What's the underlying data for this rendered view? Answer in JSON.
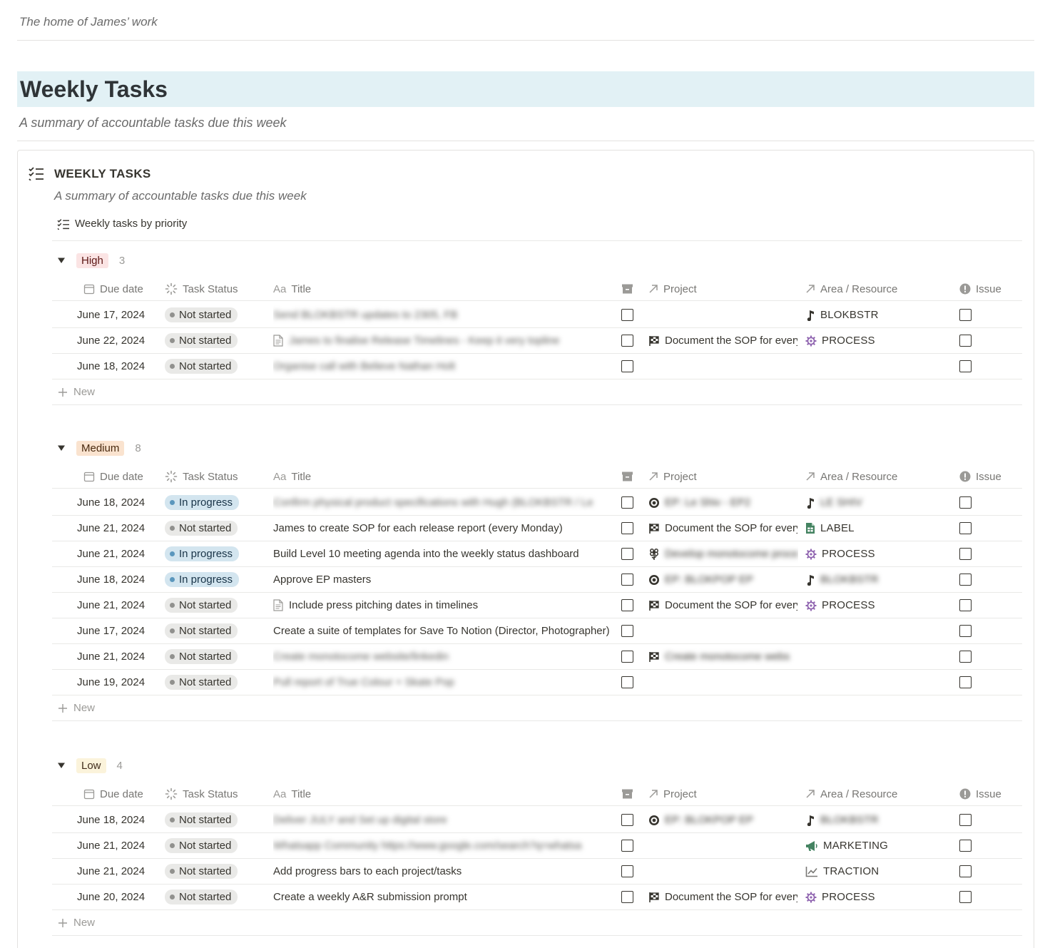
{
  "breadcrumb": "The home of James’ work",
  "page": {
    "title": "Weekly Tasks",
    "subtitle": "A summary of accountable tasks due this week"
  },
  "card": {
    "title": "WEEKLY TASKS",
    "subtitle": "A summary of accountable tasks due this week",
    "view_tab": "Weekly tasks by priority"
  },
  "columns": {
    "due_date": "Due date",
    "task_status": "Task Status",
    "title": "Title",
    "title_prefix": "Aa",
    "project": "Project",
    "area": "Area / Resource",
    "issue": "Issue"
  },
  "new_label": "New",
  "colors": {
    "page_title_bg": "#e2f1f5",
    "high_tag_bg": "#fbe4e4",
    "high_tag_fg": "#5d1715",
    "medium_tag_bg": "#fae3cf",
    "medium_tag_fg": "#49290e",
    "low_tag_bg": "#fbf3db",
    "low_tag_fg": "#402c1b",
    "status_not_started_bg": "#e9e9e7",
    "status_in_progress_bg": "#d3e5ef",
    "process_icon": "#9065b0",
    "label_icon": "#448361",
    "marketing_icon": "#448361",
    "traction_icon": "#787774"
  },
  "groups": [
    {
      "name": "High",
      "count": "3",
      "tag": "high",
      "rows": [
        {
          "date": "June 17, 2024",
          "status": "Not started",
          "status_kind": "ns",
          "title": "Send BLOKBSTR updates to 2305, FB",
          "title_blur": true,
          "title_icon": "",
          "project_icon": "",
          "project": "",
          "project_blur": false,
          "area_icon": "music-note-icon",
          "area": "BLOKBSTR",
          "area_blur": false
        },
        {
          "date": "June 22, 2024",
          "status": "Not started",
          "status_kind": "ns",
          "title": "James to finalise Release Timelines - Keep it very topline",
          "title_blur": true,
          "title_icon": "doc-icon",
          "project_icon": "checkered-flag-icon",
          "project": "Document the SOP for every release",
          "project_blur": false,
          "area_icon": "gear-icon",
          "area": "PROCESS",
          "area_blur": false
        },
        {
          "date": "June 18, 2024",
          "status": "Not started",
          "status_kind": "ns",
          "title": "Organise call with Believe Nathan Holt",
          "title_blur": true,
          "title_icon": "",
          "project_icon": "",
          "project": "",
          "project_blur": false,
          "area_icon": "",
          "area": "",
          "area_blur": false
        }
      ]
    },
    {
      "name": "Medium",
      "count": "8",
      "tag": "medium",
      "rows": [
        {
          "date": "June 18, 2024",
          "status": "In progress",
          "status_kind": "ip",
          "title": "Confirm physical product specifications with Hugh (BLOKBSTR / Le",
          "title_blur": true,
          "title_icon": "",
          "project_icon": "target-icon",
          "project": "EP: Le Shiv - EP2",
          "project_blur": true,
          "area_icon": "music-note-icon",
          "area": "LE SHIV",
          "area_blur": true
        },
        {
          "date": "June 21, 2024",
          "status": "Not started",
          "status_kind": "ns",
          "title": "James to create SOP for each release report (every Monday)",
          "title_blur": false,
          "title_icon": "",
          "project_icon": "checkered-flag-icon",
          "project": "Document the SOP for every release",
          "project_blur": false,
          "area_icon": "sheet-icon",
          "area": "LABEL",
          "area_blur": false
        },
        {
          "date": "June 21, 2024",
          "status": "In progress",
          "status_kind": "ip",
          "title": "Build Level 10 meeting agenda into the weekly status dashboard",
          "title_blur": false,
          "title_icon": "",
          "project_icon": "flower-icon",
          "project": "Develop monotocome process",
          "project_blur": true,
          "area_icon": "gear-icon",
          "area": "PROCESS",
          "area_blur": false
        },
        {
          "date": "June 18, 2024",
          "status": "In progress",
          "status_kind": "ip",
          "title": "Approve EP masters",
          "title_blur": false,
          "title_icon": "",
          "project_icon": "target-icon",
          "project": "EP: BLOKPOP EP",
          "project_blur": true,
          "area_icon": "music-note-icon",
          "area": "BLOKBSTR",
          "area_blur": true
        },
        {
          "date": "June 21, 2024",
          "status": "Not started",
          "status_kind": "ns",
          "title": "Include press pitching dates in timelines",
          "title_blur": false,
          "title_icon": "doc-icon",
          "project_icon": "checkered-flag-icon",
          "project": "Document the SOP for every release",
          "project_blur": false,
          "area_icon": "gear-icon",
          "area": "PROCESS",
          "area_blur": false
        },
        {
          "date": "June 17, 2024",
          "status": "Not started",
          "status_kind": "ns",
          "title": "Create a suite of templates for Save To Notion (Director, Photographer)",
          "title_blur": false,
          "title_icon": "",
          "project_icon": "",
          "project": "",
          "project_blur": false,
          "area_icon": "",
          "area": "",
          "area_blur": false
        },
        {
          "date": "June 21, 2024",
          "status": "Not started",
          "status_kind": "ns",
          "title": "Create monotocome website/linkedin",
          "title_blur": true,
          "title_icon": "",
          "project_icon": "checkered-flag-icon",
          "project": "Create monotocome webs",
          "project_blur": true,
          "area_icon": "",
          "area": "",
          "area_blur": false
        },
        {
          "date": "June 19, 2024",
          "status": "Not started",
          "status_kind": "ns",
          "title": "Pull report of True Colour + Skate Pop",
          "title_blur": true,
          "title_icon": "",
          "project_icon": "",
          "project": "",
          "project_blur": false,
          "area_icon": "",
          "area": "",
          "area_blur": false
        }
      ]
    },
    {
      "name": "Low",
      "count": "4",
      "tag": "low",
      "rows": [
        {
          "date": "June 18, 2024",
          "status": "Not started",
          "status_kind": "ns",
          "title": "Deliver JULY and Set up digital store",
          "title_blur": true,
          "title_icon": "",
          "project_icon": "target-icon",
          "project": "EP: BLOKPOP EP",
          "project_blur": true,
          "area_icon": "music-note-icon",
          "area": "BLOKBSTR",
          "area_blur": true
        },
        {
          "date": "June 21, 2024",
          "status": "Not started",
          "status_kind": "ns",
          "title": "Whatsapp Community https://www.google.com/search?q=whatsa",
          "title_blur": true,
          "title_icon": "",
          "project_icon": "",
          "project": "",
          "project_blur": false,
          "area_icon": "megaphone-icon",
          "area": "MARKETING",
          "area_blur": false
        },
        {
          "date": "June 21, 2024",
          "status": "Not started",
          "status_kind": "ns",
          "title": "Add progress bars to each project/tasks",
          "title_blur": false,
          "title_icon": "",
          "project_icon": "",
          "project": "",
          "project_blur": false,
          "area_icon": "chart-icon",
          "area": "TRACTION",
          "area_blur": false
        },
        {
          "date": "June 20, 2024",
          "status": "Not started",
          "status_kind": "ns",
          "title": "Create a weekly A&R submission prompt",
          "title_blur": false,
          "title_icon": "",
          "project_icon": "checkered-flag-icon",
          "project": "Document the SOP for every release",
          "project_blur": false,
          "area_icon": "gear-icon",
          "area": "PROCESS",
          "area_blur": false
        }
      ]
    }
  ]
}
